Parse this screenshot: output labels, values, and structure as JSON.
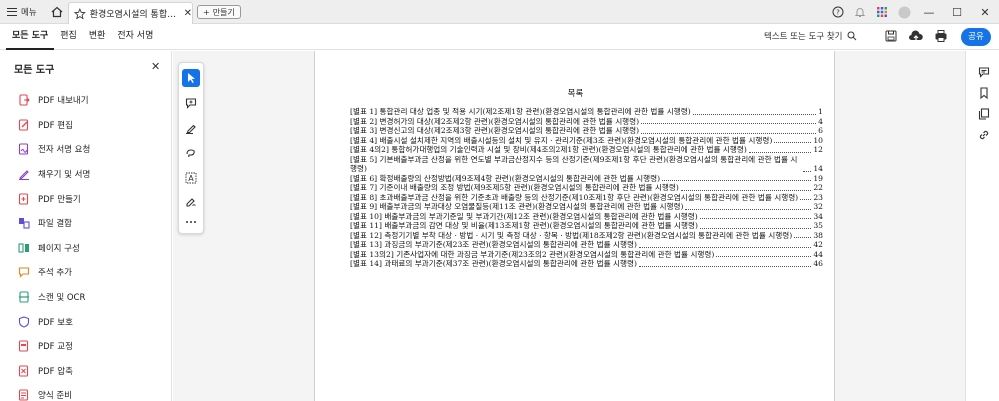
{
  "titlebar": {
    "menu_label": "메뉴",
    "tab_title": "환경오염시설의 통합…",
    "new_button_label": "만들기",
    "icons": [
      "home-icon",
      "star-icon",
      "help-icon",
      "bell-icon",
      "apps-grid-icon",
      "avatar-icon"
    ]
  },
  "toolbar": {
    "tabs": [
      "모든 도구",
      "편집",
      "변환",
      "전자 서명"
    ],
    "active_tab": "모든 도구",
    "search_label": "텍스트 또는 도구 찾기",
    "share_label": "공유",
    "share_color": "#1473e6"
  },
  "leftpanel": {
    "title": "모든 도구",
    "items": [
      {
        "label": "PDF 내보내기",
        "icon": "export-pdf-icon",
        "color": "#e34850"
      },
      {
        "label": "PDF 편집",
        "icon": "edit-pdf-icon",
        "color": "#e34850"
      },
      {
        "label": "전자 서명 요청",
        "icon": "request-signature-icon",
        "color": "#8e3cca"
      },
      {
        "label": "채우기 및 서명",
        "icon": "fill-sign-icon",
        "color": "#8e3cca"
      },
      {
        "label": "PDF 만들기",
        "icon": "create-pdf-icon",
        "color": "#e34850"
      },
      {
        "label": "파일 결합",
        "icon": "combine-files-icon",
        "color": "#5b4fd6"
      },
      {
        "label": "페이지 구성",
        "icon": "organize-pages-icon",
        "color": "#2d9d78"
      },
      {
        "label": "주석 추가",
        "icon": "comment-icon",
        "color": "#e68619"
      },
      {
        "label": "스캔 및 OCR",
        "icon": "scan-ocr-icon",
        "color": "#2d9d78"
      },
      {
        "label": "PDF 보호",
        "icon": "protect-pdf-icon",
        "color": "#5b4fd6"
      },
      {
        "label": "PDF 교정",
        "icon": "redact-pdf-icon",
        "color": "#e34850"
      },
      {
        "label": "PDF 압축",
        "icon": "compress-pdf-icon",
        "color": "#e34850"
      },
      {
        "label": "양식 준비",
        "icon": "prepare-form-icon",
        "color": "#e34850"
      }
    ]
  },
  "quicktools": [
    "select-cursor-icon",
    "add-comment-icon",
    "highlight-pen-icon",
    "draw-freehand-icon",
    "add-text-icon",
    "sign-icon",
    "more-icon"
  ],
  "document": {
    "title": "목록",
    "entries": [
      {
        "text": "[별표 1] 통합관리 대상 업종 및 적용 시기(제2조제1항 관련)(환경오염시설의 통합관리에 관한 법률 시행령)",
        "page": "1"
      },
      {
        "text": "[별표 2] 변경허가의 대상(제2조제2항 관련)(환경오염시설의 통합관리에 관한 법률 시행령)",
        "page": "4"
      },
      {
        "text": "[별표 3] 변경신고의 대상(제2조제3항 관련)(환경오염시설의 통합관리에 관한 법률 시행령)",
        "page": "6"
      },
      {
        "text": "[별표 4] 배출시설 설치제한 지역의 배출시설등의 설치 및 유지 · 관리기준(제3조 관련)(환경오염시설의 통합관리에 관한 법률 시행령)",
        "page": "10"
      },
      {
        "text": "[별표 4의2] 통합허가대행업의 기술인력과 시설 및 장비(제4조의2제1항 관련)(환경오염시설의 통합관리에 관한 법률 시행령)",
        "page": "12"
      },
      {
        "text": "[별표 5] 기본배출부과금 산정을 위한 연도별 부과금산정지수 등의 산정기준(제9조제1항 후단 관련)(환경오염시설의 통합관리에 관한 법률 시행령)",
        "page": "14"
      },
      {
        "text": "[별표 6] 확정배출량의 산정방법(제9조제4항 관련)(환경오염시설의 통합관리에 관한 법률 시행령)",
        "page": "19"
      },
      {
        "text": "[별표 7] 기준이내 배출량의 조정 방법(제9조제5항 관련)(환경오염시설의 통합관리에 관한 법률 시행령)",
        "page": "22"
      },
      {
        "text": "[별표 8] 초과배출부과금 산정을 위한 기준초과 배출량 등의 산정기준(제10조제1항 후단 관련)(환경오염시설의 통합관리에 관한 법률 시행령)",
        "page": "23"
      },
      {
        "text": "[별표 9] 배출부과금의 부과대상 오염물질등(제11조 관련)(환경오염시설의 통합관리에 관한 법률 시행령)",
        "page": "32"
      },
      {
        "text": "[별표 10] 배출부과금의 부과기준일 및 부과기간(제12조 관련)(환경오염시설의 통합관리에 관한 법률 시행령)",
        "page": "34"
      },
      {
        "text": "[별표 11] 배출부과금의 감면 대상 및 비율(제13조제1항 관련)(환경오염시설의 통합관리에 관한 법률 시행령)",
        "page": "35"
      },
      {
        "text": "[별표 12] 측정기기별 부착 대상 · 방법 · 시기 및 측정 대상 · 항목 · 방법(제18조제2항 관련)(환경오염시설의 통합관리에 관한 법률 시행령)",
        "page": "38"
      },
      {
        "text": "[별표 13] 과징금의 부과기준(제23조 관련)(환경오염시설의 통합관리에 관한 법률 시행령)",
        "page": "42"
      },
      {
        "text": "[별표 13의2] 기존사업자에 대한 과징금 부과기준(제23조의2 관련)(환경오염시설의 통합관리에 관한 법률 시행령)",
        "page": "44"
      },
      {
        "text": "[별표 14] 과태료의 부과기준(제37조 관련)(환경오염시설의 통합관리에 관한 법률 시행령)",
        "page": "46"
      }
    ]
  },
  "rightrail": [
    "comments-panel-icon",
    "bookmarks-icon",
    "pages-icon",
    "attachments-link-icon"
  ]
}
